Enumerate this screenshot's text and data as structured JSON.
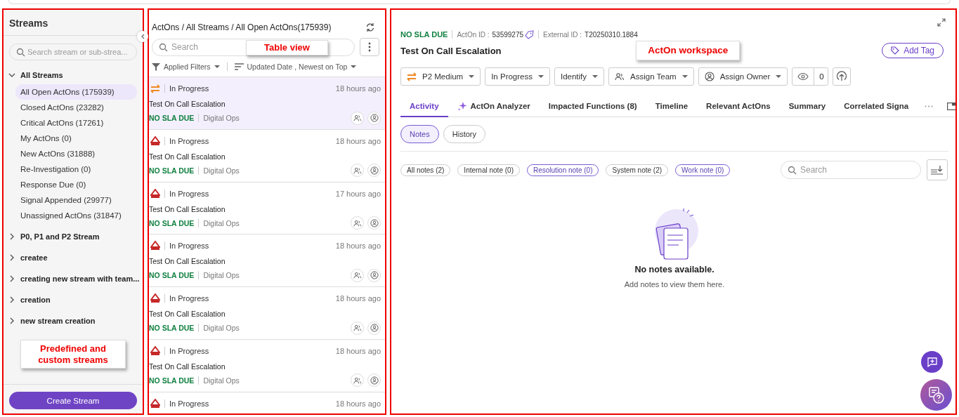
{
  "sidebar": {
    "title": "Streams",
    "search": {
      "placeholder": "Search stream or sub-strea..."
    },
    "groups": [
      {
        "label": "All Streams",
        "expanded": true,
        "children": [
          {
            "label": "All Open ActOns (175939)",
            "selected": true
          },
          {
            "label": "Closed ActOns (23282)",
            "selected": false
          },
          {
            "label": "Critical ActOns (17261)",
            "selected": false
          },
          {
            "label": "My ActOns (0)",
            "selected": false
          },
          {
            "label": "New ActOns (31888)",
            "selected": false
          },
          {
            "label": "Re-Investigation (0)",
            "selected": false
          },
          {
            "label": "Response Due (0)",
            "selected": false
          },
          {
            "label": "Signal Appended (29977)",
            "selected": false
          },
          {
            "label": "Unassigned ActOns (31847)",
            "selected": false
          }
        ]
      },
      {
        "label": "P0, P1 and P2 Stream",
        "expanded": false
      },
      {
        "label": "createe",
        "expanded": false
      },
      {
        "label": "creating new stream with team...",
        "expanded": false
      },
      {
        "label": "creation",
        "expanded": false
      },
      {
        "label": "new stream creation",
        "expanded": false
      }
    ],
    "callout": "Predefined and custom streams",
    "create_button": "Create Stream"
  },
  "list": {
    "breadcrumb": "ActOns / All Streams / All Open ActOns(175939)",
    "search": {
      "placeholder": "Search"
    },
    "callout": "Table view",
    "filter": "Applied Filters",
    "sort": "Updated Date , Newest on Top",
    "rows": [
      {
        "kind": "medium",
        "status": "In Progress",
        "time": "18 hours ago",
        "title": "Test On Call Escalation",
        "sla": "NO SLA DUE",
        "team": "Digital Ops",
        "selected": true
      },
      {
        "kind": "high",
        "status": "In Progress",
        "time": "18 hours ago",
        "title": "Test On Call Escalation",
        "sla": "NO SLA DUE",
        "team": "Digital Ops",
        "selected": false
      },
      {
        "kind": "high",
        "status": "In Progress",
        "time": "17 hours ago",
        "title": "Test On Call Escalation",
        "sla": "NO SLA DUE",
        "team": "Digital Ops",
        "selected": false
      },
      {
        "kind": "high",
        "status": "In Progress",
        "time": "18 hours ago",
        "title": "Test On Call Escalation",
        "sla": "NO SLA DUE",
        "team": "Digital Ops",
        "selected": false
      },
      {
        "kind": "high",
        "status": "In Progress",
        "time": "18 hours ago",
        "title": "Test On Call Escalation",
        "sla": "NO SLA DUE",
        "team": "Digital Ops",
        "selected": false
      },
      {
        "kind": "high",
        "status": "In Progress",
        "time": "18 hours ago",
        "title": "Test On Call Escalation",
        "sla": "NO SLA DUE",
        "team": "Digital Ops",
        "selected": false
      },
      {
        "kind": "high",
        "status": "In Progress",
        "time": "18 hours ago",
        "selected": false
      }
    ]
  },
  "workspace": {
    "sla": "NO SLA DUE",
    "acton_id_label": "ActOn ID :",
    "acton_id": "53599275",
    "external_id_label": "External ID :",
    "external_id": "T20250310.1884",
    "title": "Test On Call Escalation",
    "callout": "ActOn workspace",
    "add_tag": "Add Tag",
    "dropdowns": [
      {
        "kind": "priority",
        "label": "P2 Medium"
      },
      {
        "kind": "plain",
        "label": "In Progress"
      },
      {
        "kind": "plain",
        "label": "Identify"
      },
      {
        "kind": "team",
        "label": "Assign Team"
      },
      {
        "kind": "owner",
        "label": "Assign Owner"
      }
    ],
    "watchers": "0",
    "tabs": [
      {
        "label": "Activity",
        "selected": true,
        "kind": "text"
      },
      {
        "label": "ActOn Analyzer",
        "selected": false,
        "kind": "ai"
      },
      {
        "label": "Impacted Functions (8)",
        "selected": false,
        "kind": "text"
      },
      {
        "label": "Timeline",
        "selected": false,
        "kind": "text"
      },
      {
        "label": "Relevant ActOns",
        "selected": false,
        "kind": "text"
      },
      {
        "label": "Summary",
        "selected": false,
        "kind": "text"
      },
      {
        "label": "Correlated Signa",
        "selected": false,
        "kind": "text"
      }
    ],
    "subtabs": [
      {
        "label": "Notes",
        "selected": true
      },
      {
        "label": "History",
        "selected": false
      }
    ],
    "filters": [
      {
        "label": "All notes (2)",
        "selected": false
      },
      {
        "label": "Internal note (0)",
        "selected": false
      },
      {
        "label": "Resolution note (0)",
        "selected": true
      },
      {
        "label": "System note (2)",
        "selected": false
      },
      {
        "label": "Work note (0)",
        "selected": true
      }
    ],
    "search": {
      "placeholder": "Search"
    },
    "empty": {
      "title": "No notes available.",
      "text": "Add notes to view them here."
    }
  }
}
